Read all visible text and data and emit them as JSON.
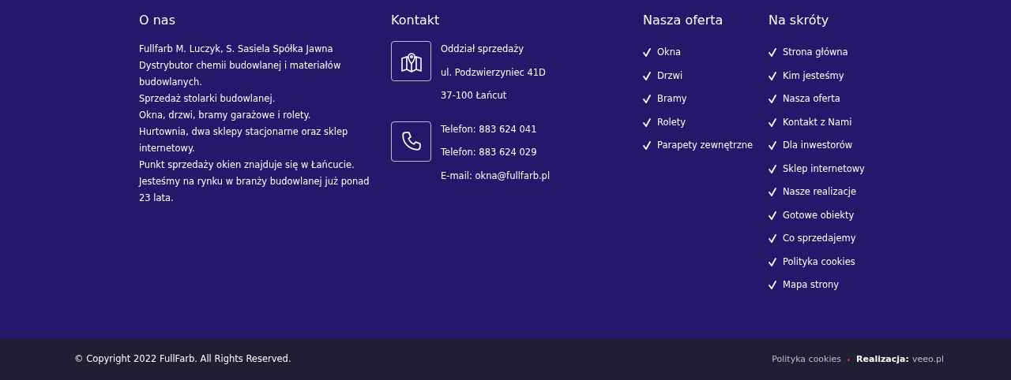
{
  "about": {
    "title": "O nas",
    "lines": [
      "Fullfarb M. Luczyk, S. Sasiela Spółka Jawna",
      "Dystrybutor chemii budowlanej i materiałów budowlanych.",
      "Sprzedaż stolarki budowlanej.",
      "Okna, drzwi, bramy garażowe i rolety.",
      "Hurtownia, dwa sklepy stacjonarne oraz sklep internetowy.",
      "Punkt sprzedaży okien znajduje się w Łańcucie.",
      "Jesteśmy na rynku w branży budowlanej już ponad 23 lata."
    ]
  },
  "contact": {
    "title": "Kontakt",
    "groups": [
      {
        "kind": "map",
        "lines": [
          "Oddział sprzedaży",
          "ul. Podzwierzyniec 41D",
          "37-100 Łańcut"
        ]
      },
      {
        "kind": "phone",
        "lines": [
          "Telefon: 883 624 041",
          "Telefon: 883 624 029",
          "E-mail: okna@fullfarb.pl"
        ]
      }
    ]
  },
  "offer": {
    "title": "Nasza oferta",
    "items": [
      "Okna",
      "Drzwi",
      "Bramy",
      "Rolety",
      "Parapety zewnętrzne"
    ]
  },
  "shortcuts": {
    "title": "Na skróty",
    "items": [
      "Strona główna",
      "Kim jesteśmy",
      "Nasza oferta",
      "Kontakt z Nami",
      "Dla inwestorów",
      "Sklep internetowy",
      "Nasze realizacje",
      "Gotowe obiekty",
      "Co sprzedajemy",
      "Polityka cookies",
      "Mapa strony"
    ]
  },
  "bottom_bar": {
    "copyright": "© Copyright 2022 FullFarb. All Rights Reserved.",
    "cookies_link": "Polityka cookies",
    "credit_label": "Realizacja:",
    "credit_link": "veeo.pl"
  }
}
